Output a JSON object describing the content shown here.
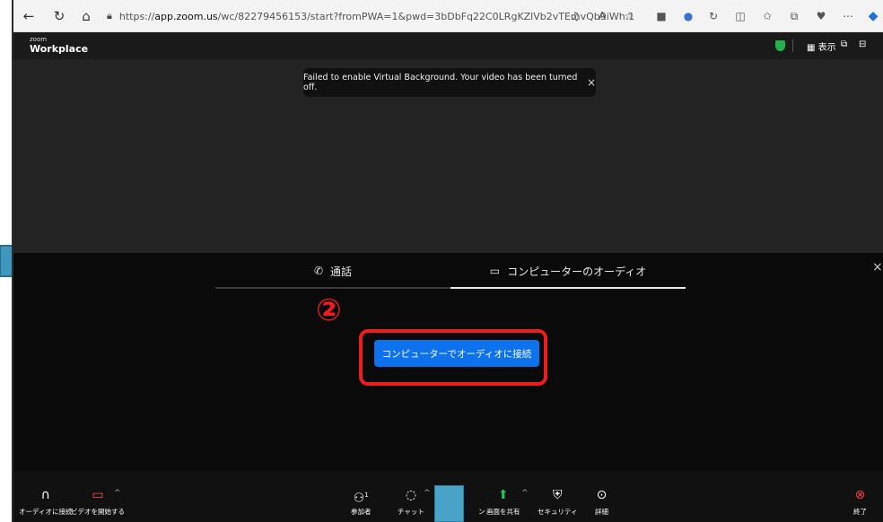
{
  "browser": {
    "url_prefix": "https://",
    "url_host": "app.zoom.us",
    "url_path": "/wc/82279456153/start?fromPWA=1&pwd=3bDbFq22C0LRgKZlVb2vTEmvQb9iWh.1"
  },
  "header": {
    "brand_small": "zoom",
    "brand": "Workplace",
    "view_label": "表示"
  },
  "toast": {
    "message": "Failed to enable Virtual Background. Your video has been turned off.",
    "close": "×"
  },
  "audio_panel": {
    "tabs": [
      {
        "label": "通話",
        "active": false
      },
      {
        "label": "コンピューターのオーディオ",
        "active": true
      }
    ],
    "close": "×",
    "join_button": "コンピューターでオーディオに接続",
    "step_number": "②",
    "accent_color": "#0e72ed",
    "highlight_color": "#ee1c1c"
  },
  "toolbar": {
    "audio": "オーディオに接続",
    "video": "ビデオを開始する",
    "participants": "参加者",
    "participants_count": "1",
    "chat": "チャット",
    "reactions_partial": "ン",
    "share": "画面を共有",
    "security": "セキュリティ",
    "more": "詳細",
    "end": "終了"
  }
}
